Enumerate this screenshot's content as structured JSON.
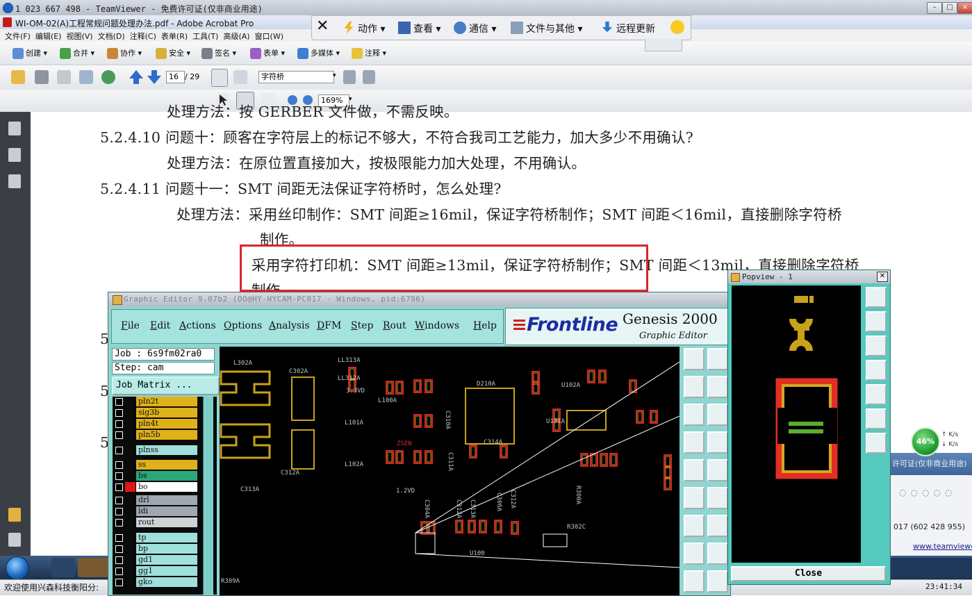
{
  "teamviewer": {
    "title": "1 023 667 498 - TeamViewer - 免费许可证(仅非商业用途)",
    "toolbar": {
      "actions": "动作",
      "view": "查看",
      "comm": "通信",
      "files": "文件与其他",
      "update": "远程更新"
    }
  },
  "acrobat": {
    "title": "WI-OM-02(A)工程常规问题处理办法.pdf - Adobe Acrobat Pro",
    "menu": [
      "文件(F)",
      "编辑(E)",
      "视图(V)",
      "文档(D)",
      "注释(C)",
      "表单(R)",
      "工具(T)",
      "高级(A)",
      "窗口(W)"
    ],
    "toolbar1": [
      "创建",
      "合并",
      "协作",
      "安全",
      "签名",
      "表单",
      "多媒体",
      "注释"
    ],
    "page_current": "16",
    "page_total": "/ 29",
    "search_value": "字符桥",
    "zoom": "169%"
  },
  "document": {
    "lines": [
      "处理方法：按 GERBER 文件做，不需反映。",
      "5.2.4.10  问题十：顾客在字符层上的标记不够大，不符合我司工艺能力，加大多少不用确认?",
      "处理方法：在原位置直接加大，按极限能力加大处理，不用确认。",
      "5.2.4.11  问题十一：SMT 间距无法保证字符桥时，怎么处理?",
      "处理方法：采用丝印制作：SMT 间距≥16mil，保证字符桥制作；SMT 间距＜16mil，直接删除字符桥",
      "制作。",
      "采用字符打印机：SMT 间距≥13mil，保证字符桥制作；SMT 间距＜13mil，直接删除字符桥",
      "制作。"
    ],
    "section_marks": [
      "5",
      "5",
      "5"
    ]
  },
  "genesis": {
    "title": "Graphic Editor 9.07b2 (OO@HY-HYCAM-PC017 - Windows, pid:6796)",
    "menu": [
      "File",
      "Edit",
      "Actions",
      "Options",
      "Analysis",
      "DFM",
      "Step",
      "Rout",
      "Windows",
      "Help"
    ],
    "logo_brand": "Frontline",
    "product": "Genesis 2000",
    "product_sub": "Graphic Editor",
    "job": "Job : 6s9fm02ra0",
    "step": "Step: cam",
    "job_matrix": "Job Matrix ...",
    "layers": [
      {
        "name": "pln2t",
        "color": "#e0b21a"
      },
      {
        "name": "sig3b",
        "color": "#e0b21a"
      },
      {
        "name": "pln4t",
        "color": "#e0b21a"
      },
      {
        "name": "pln5b",
        "color": "#e0b21a"
      },
      {
        "name": "plnss",
        "color": "#9fe0dc"
      },
      {
        "name": "ss",
        "color": "#e0b21a"
      },
      {
        "name": "bs",
        "color": "#2aa87a"
      },
      {
        "name": "bo",
        "color": "#ffffff"
      },
      {
        "name": "drl",
        "color": "#9fa8b0"
      },
      {
        "name": "ldi",
        "color": "#9fa8b0"
      },
      {
        "name": "rout",
        "color": "#cfd3d6"
      },
      {
        "name": "tp",
        "color": "#9fe0dc"
      },
      {
        "name": "bp",
        "color": "#9fe0dc"
      },
      {
        "name": "gd1",
        "color": "#9fe0dc"
      },
      {
        "name": "gg1",
        "color": "#9fe0dc"
      },
      {
        "name": "gko",
        "color": "#9fe0dc"
      }
    ],
    "canvas_labels": [
      "L302A",
      "C302A",
      "LL313A",
      "LL312A",
      "3.3VD",
      "L100A",
      "L101A",
      "D210A",
      "U102A",
      "C310A",
      "C311A",
      "C312A",
      "C313A",
      "C314A",
      "L102A",
      "U101A",
      "1.2VD",
      "ZSEN",
      "R300A",
      "C312A",
      "C313A",
      "C304A",
      "C306A",
      "U100",
      "R302C",
      "R309A",
      "C312A"
    ]
  },
  "popview": {
    "title": "Popview - 1",
    "close_label": "Close"
  },
  "tray": {
    "net_percent": "46%",
    "net_up": "K/s",
    "net_down": "K/s",
    "tv_blurb": "许可证(仅非商业用途)",
    "tv_number": "017 (602 428 955)",
    "tv_url": "www.teamviewer"
  },
  "statusbar": {
    "left": "欢迎使用兴森科技衡阳分:",
    "clock": "23:41:34"
  }
}
